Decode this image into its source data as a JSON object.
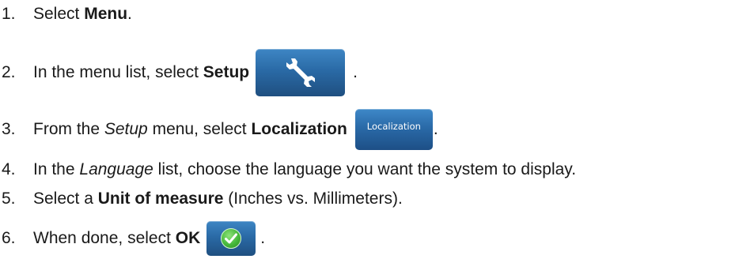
{
  "steps": [
    {
      "number": "1.",
      "before": "Select ",
      "bold": "Menu",
      "after": "."
    },
    {
      "number": "2.",
      "before": "In the menu list, select ",
      "bold": "Setup",
      "after": "."
    },
    {
      "number": "3.",
      "before": "From the ",
      "italic": "Setup",
      "middle": " menu, select ",
      "bold": "Localization",
      "after": "."
    },
    {
      "number": "4.",
      "before": "In the ",
      "italic": "Language",
      "after": " list, choose the language you want the system to display."
    },
    {
      "number": "5.",
      "before": "Select a ",
      "bold": "Unit of measure",
      "after": " (Inches vs. Millimeters)."
    },
    {
      "number": "6.",
      "before": "When done, select ",
      "bold": "OK",
      "after": "."
    }
  ],
  "buttons": {
    "setup_icon": "wrench-icon",
    "localization_label": "Localization",
    "ok_icon": "checkmark-icon"
  },
  "colors": {
    "button_blue_top": "#3e86c4",
    "button_blue_bottom": "#1f4f80",
    "check_green": "#45b83a"
  }
}
